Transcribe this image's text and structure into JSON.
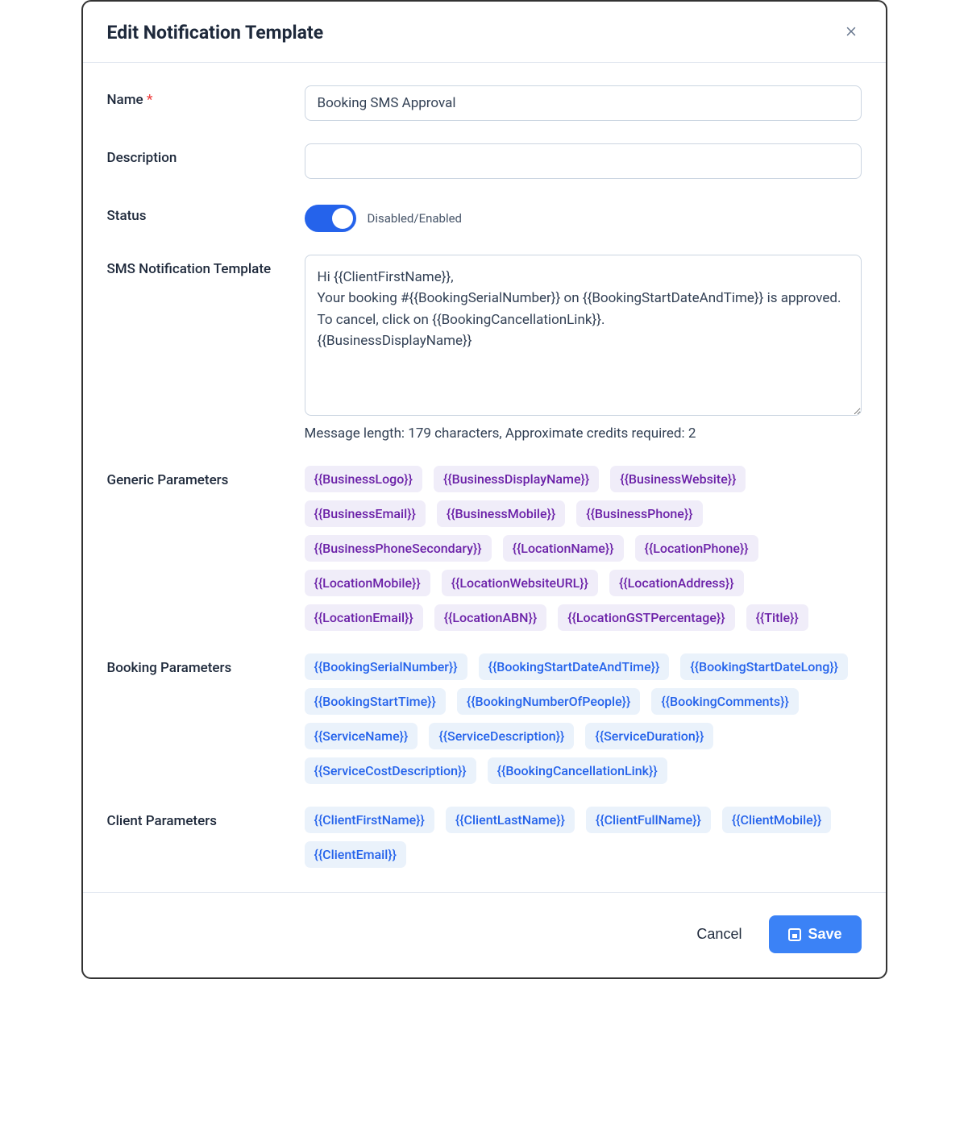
{
  "header": {
    "title": "Edit Notification Template"
  },
  "labels": {
    "name": "Name",
    "required_mark": "*",
    "description": "Description",
    "status": "Status",
    "sms_template": "SMS Notification Template",
    "generic_params": "Generic Parameters",
    "booking_params": "Booking Parameters",
    "client_params": "Client Parameters"
  },
  "fields": {
    "name_value": "Booking SMS Approval",
    "description_value": "",
    "status_enabled": true,
    "status_caption": "Disabled/Enabled",
    "sms_template_value": "Hi {{ClientFirstName}},\nYour booking #{{BookingSerialNumber}} on {{BookingStartDateAndTime}} is approved.\nTo cancel, click on {{BookingCancellationLink}}.\n{{BusinessDisplayName}}"
  },
  "message_info": {
    "length_label": "Message length: ",
    "length_value": "179 characters,",
    "credits_label": "   Approximate credits required: ",
    "credits_value": "2"
  },
  "generic_parameters": [
    "{{BusinessLogo}}",
    "{{BusinessDisplayName}}",
    "{{BusinessWebsite}}",
    "{{BusinessEmail}}",
    "{{BusinessMobile}}",
    "{{BusinessPhone}}",
    "{{BusinessPhoneSecondary}}",
    "{{LocationName}}",
    "{{LocationPhone}}",
    "{{LocationMobile}}",
    "{{LocationWebsiteURL}}",
    "{{LocationAddress}}",
    "{{LocationEmail}}",
    "{{LocationABN}}",
    "{{LocationGSTPercentage}}",
    "{{Title}}"
  ],
  "booking_parameters": [
    "{{BookingSerialNumber}}",
    "{{BookingStartDateAndTime}}",
    "{{BookingStartDateLong}}",
    "{{BookingStartTime}}",
    "{{BookingNumberOfPeople}}",
    "{{BookingComments}}",
    "{{ServiceName}}",
    "{{ServiceDescription}}",
    "{{ServiceDuration}}",
    "{{ServiceCostDescription}}",
    "{{BookingCancellationLink}}"
  ],
  "client_parameters": [
    "{{ClientFirstName}}",
    "{{ClientLastName}}",
    "{{ClientFullName}}",
    "{{ClientMobile}}",
    "{{ClientEmail}}"
  ],
  "footer": {
    "cancel": "Cancel",
    "save": "Save"
  }
}
